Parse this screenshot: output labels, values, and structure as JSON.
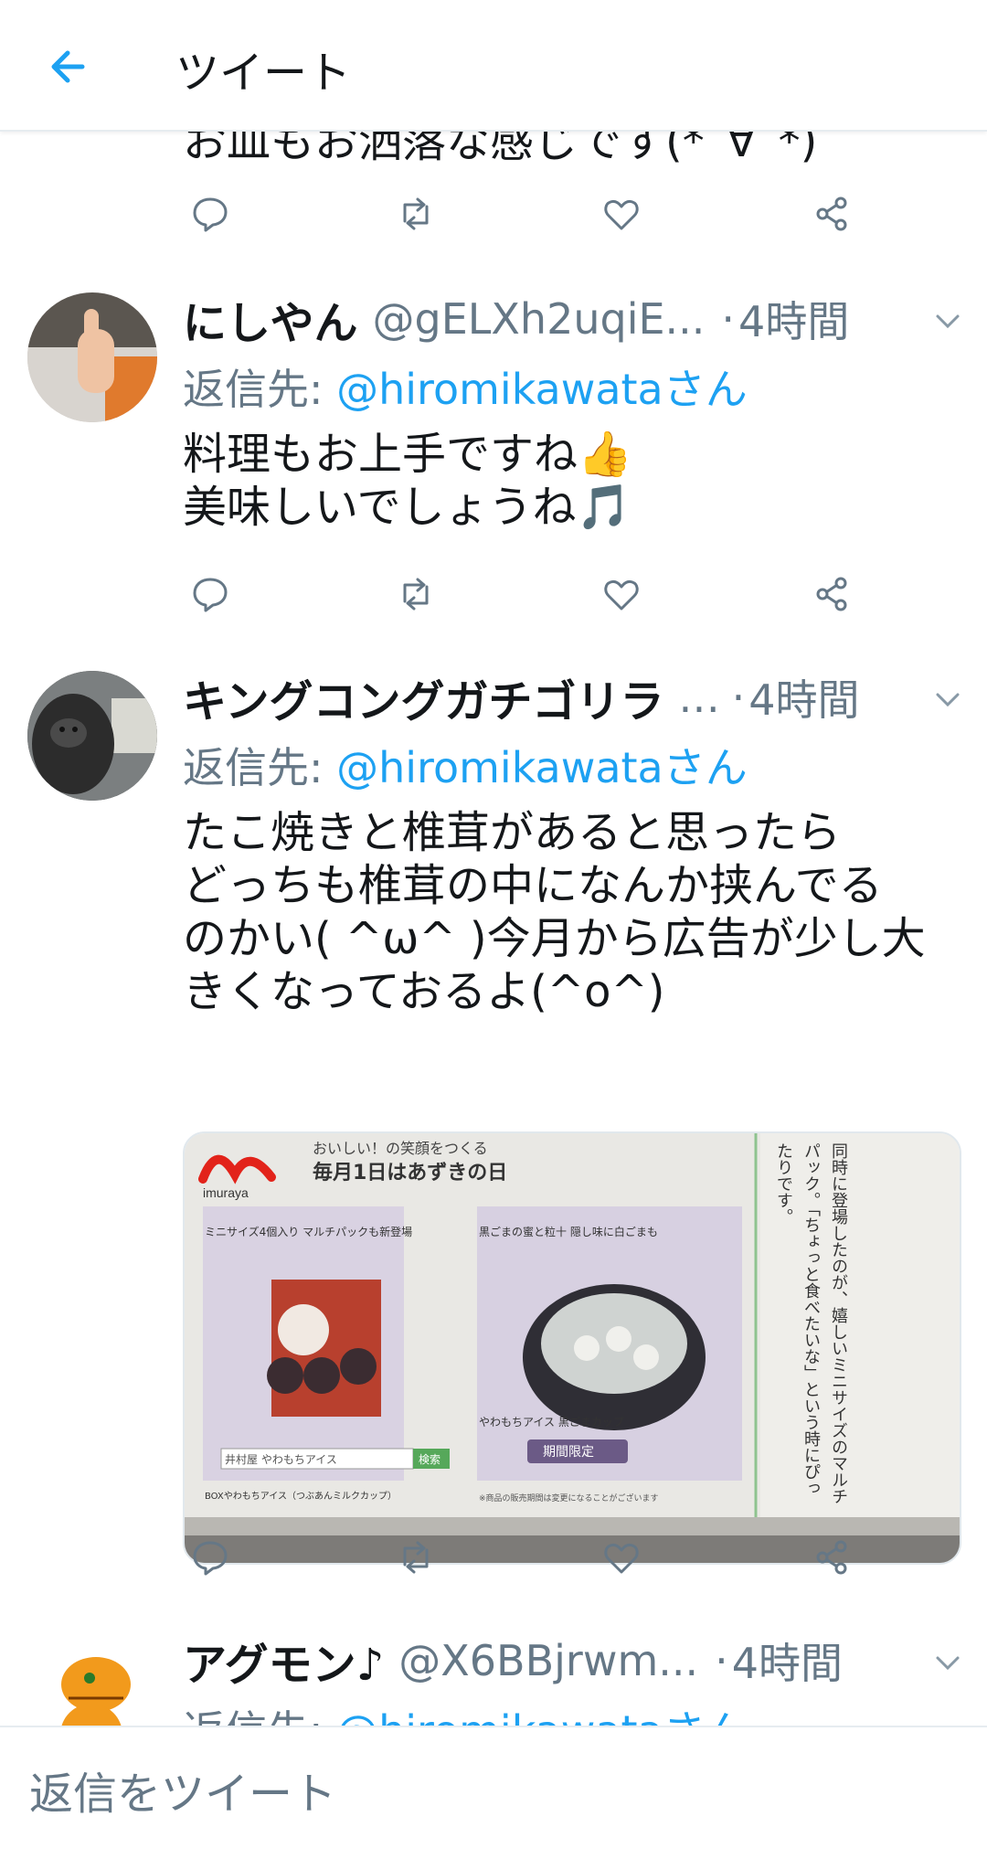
{
  "header": {
    "title": "ツイート"
  },
  "partial_tweet": {
    "text": "お皿もお洒落な感じです(*´∀`*)"
  },
  "tweets": [
    {
      "name": "にしやん",
      "handle": "@gELXh2uqiE...",
      "time": "4時間",
      "reply_prefix": "返信先: ",
      "reply_mention": "@hiromikawataさん",
      "text": "料理もお上手ですね👍\n美味しいでしょうね🎵"
    },
    {
      "name": "キングコングガチゴリラ",
      "handle": "...",
      "time": "4時間",
      "reply_prefix": "返信先: ",
      "reply_mention": "@hiromikawataさん",
      "text": "たこ焼きと椎茸があると思ったら\nどっちも椎茸の中になんか挟んでる\nのかい( ^ω^ )今月から広告が少し大\nきくなっておるよ(^o^)",
      "media": {
        "brand": "imuraya",
        "headline": "おいしい！の笑顔をつくる",
        "subhead": "毎月1日はあずきの日",
        "left_badge": "ミニサイズ4個入り マルチパックも新登場",
        "left_product": "BOXやわもちアイス（つぶあんミルクカップ）",
        "left_search_label": "井村屋 やわもちアイス",
        "search_button": "検索",
        "right_badge": "黒ごまの蜜と粒十 隠し味に白ごまも",
        "right_product": "やわもちアイス 黒ごまカップ",
        "limited": "期間限定",
        "note": "※商品の販売期間は変更になることがございます",
        "column_text": "同時に登場したのが、嬉しいミニサイズのマルチパック。「ちょっと食べたいな」という時にぴったりです。"
      }
    },
    {
      "name": "アグモン♪",
      "handle": "@X6BBjrwm...",
      "time": "4時間",
      "reply_prefix": "返信先: ",
      "reply_mention": "@hiromikawataさん"
    }
  ],
  "dot_separator": "·",
  "reply_bar": {
    "placeholder": "返信をツイート"
  },
  "colors": {
    "accent": "#1da1f2",
    "secondary_text": "#657786",
    "divider": "#e6ecf0"
  }
}
